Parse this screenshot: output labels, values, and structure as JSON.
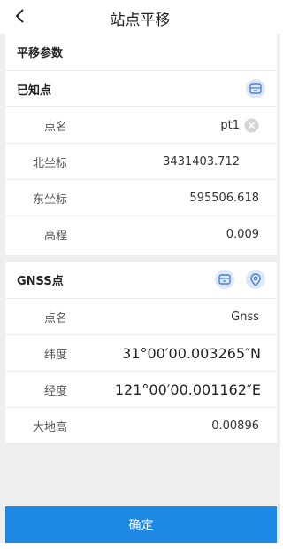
{
  "header": {
    "title": "站点平移"
  },
  "params_section": {
    "label": "平移参数"
  },
  "known_point": {
    "label": "已知点",
    "fields": [
      {
        "label": "点名",
        "value": "pt1"
      },
      {
        "label": "北坐标",
        "value": "3431403.712"
      },
      {
        "label": "东坐标",
        "value": "595506.618"
      },
      {
        "label": "高程",
        "value": "0.009"
      }
    ]
  },
  "gnss_point": {
    "label": "GNSS点",
    "fields": [
      {
        "label": "点名",
        "value": "Gnss"
      },
      {
        "label": "纬度",
        "value": "31°00′00.003265″N"
      },
      {
        "label": "经度",
        "value": "121°00′00.001162″E"
      },
      {
        "label": "大地高",
        "value": "0.00896"
      }
    ]
  },
  "footer": {
    "confirm_label": "确定"
  },
  "colors": {
    "accent": "#1e88e5",
    "icon_bg": "#dde8f8",
    "icon_fg": "#4a7fd1"
  },
  "icons": [
    "back-arrow-icon",
    "clear-icon",
    "point-library-icon",
    "location-pin-icon"
  ]
}
